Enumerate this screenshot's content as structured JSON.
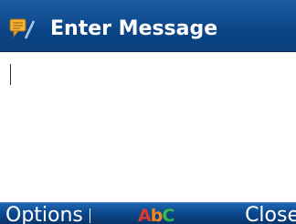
{
  "header": {
    "title": "Enter Message",
    "icon": "message-pen-icon"
  },
  "editor": {
    "value": ""
  },
  "softkeys": {
    "left": "Options",
    "right": "Close",
    "input_mode": {
      "first": "A",
      "second": "b",
      "third": "C"
    }
  },
  "colors": {
    "header_bg": "#0b4587",
    "softkey_bg": "#0c4a90",
    "accent_red": "#e0392b",
    "accent_orange": "#f08a1c",
    "accent_green": "#3bb44a"
  }
}
